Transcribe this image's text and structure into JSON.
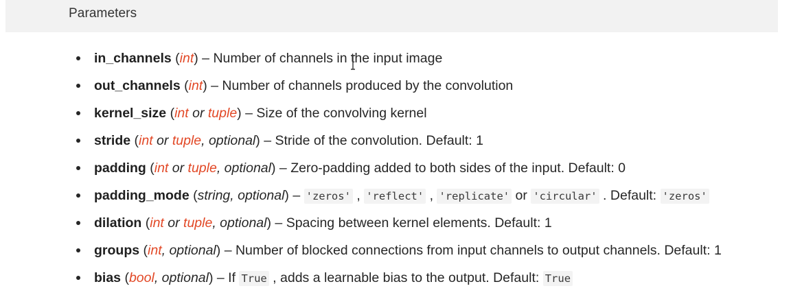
{
  "header": {
    "title": "Parameters"
  },
  "params": [
    {
      "name": "in_channels",
      "type_open": "(",
      "type_a": "int",
      "type_close": ")",
      "dash": " – ",
      "desc": "Number of channels in the input image"
    },
    {
      "name": "out_channels",
      "type_open": "(",
      "type_a": "int",
      "type_close": ")",
      "dash": " – ",
      "desc": "Number of channels produced by the convolution"
    },
    {
      "name": "kernel_size",
      "type_open": "(",
      "type_a": "int",
      "type_or": " or ",
      "type_b": "tuple",
      "type_close": ")",
      "dash": " – ",
      "desc": "Size of the convolving kernel"
    },
    {
      "name": "stride",
      "type_open": "(",
      "type_a": "int",
      "type_or": " or ",
      "type_b": "tuple",
      "type_opt": ", optional",
      "type_close": ")",
      "dash": " – ",
      "desc": "Stride of the convolution. Default: 1"
    },
    {
      "name": "padding",
      "type_open": "(",
      "type_a": "int",
      "type_or": " or ",
      "type_b": "tuple",
      "type_opt": ", optional",
      "type_close": ")",
      "dash": " – ",
      "desc": "Zero-padding added to both sides of the input. Default: 0"
    },
    {
      "name": "padding_mode",
      "type_open": "(",
      "type_plain": "string, optional",
      "type_close": ")",
      "dash": " – ",
      "code1": "'zeros'",
      "sep1": " , ",
      "code2": "'reflect'",
      "sep2": " , ",
      "code3": "'replicate'",
      "sep3": " or ",
      "code4": "'circular'",
      "sep4": " . Default: ",
      "code5": "'zeros'"
    },
    {
      "name": "dilation",
      "type_open": "(",
      "type_a": "int",
      "type_or": " or ",
      "type_b": "tuple",
      "type_opt": ", optional",
      "type_close": ")",
      "dash": " – ",
      "desc": "Spacing between kernel elements. Default: 1"
    },
    {
      "name": "groups",
      "type_open": "(",
      "type_a": "int",
      "type_opt": ", optional",
      "type_close": ")",
      "dash": " – ",
      "desc": "Number of blocked connections from input channels to output channels. Default: 1"
    },
    {
      "name": "bias",
      "type_open": "(",
      "type_a": "bool",
      "type_opt": ", optional",
      "type_close": ")",
      "dash": " – ",
      "pre": "If ",
      "code1": "True",
      "mid": " , adds a learnable bias to the output. Default: ",
      "code2": "True"
    }
  ]
}
